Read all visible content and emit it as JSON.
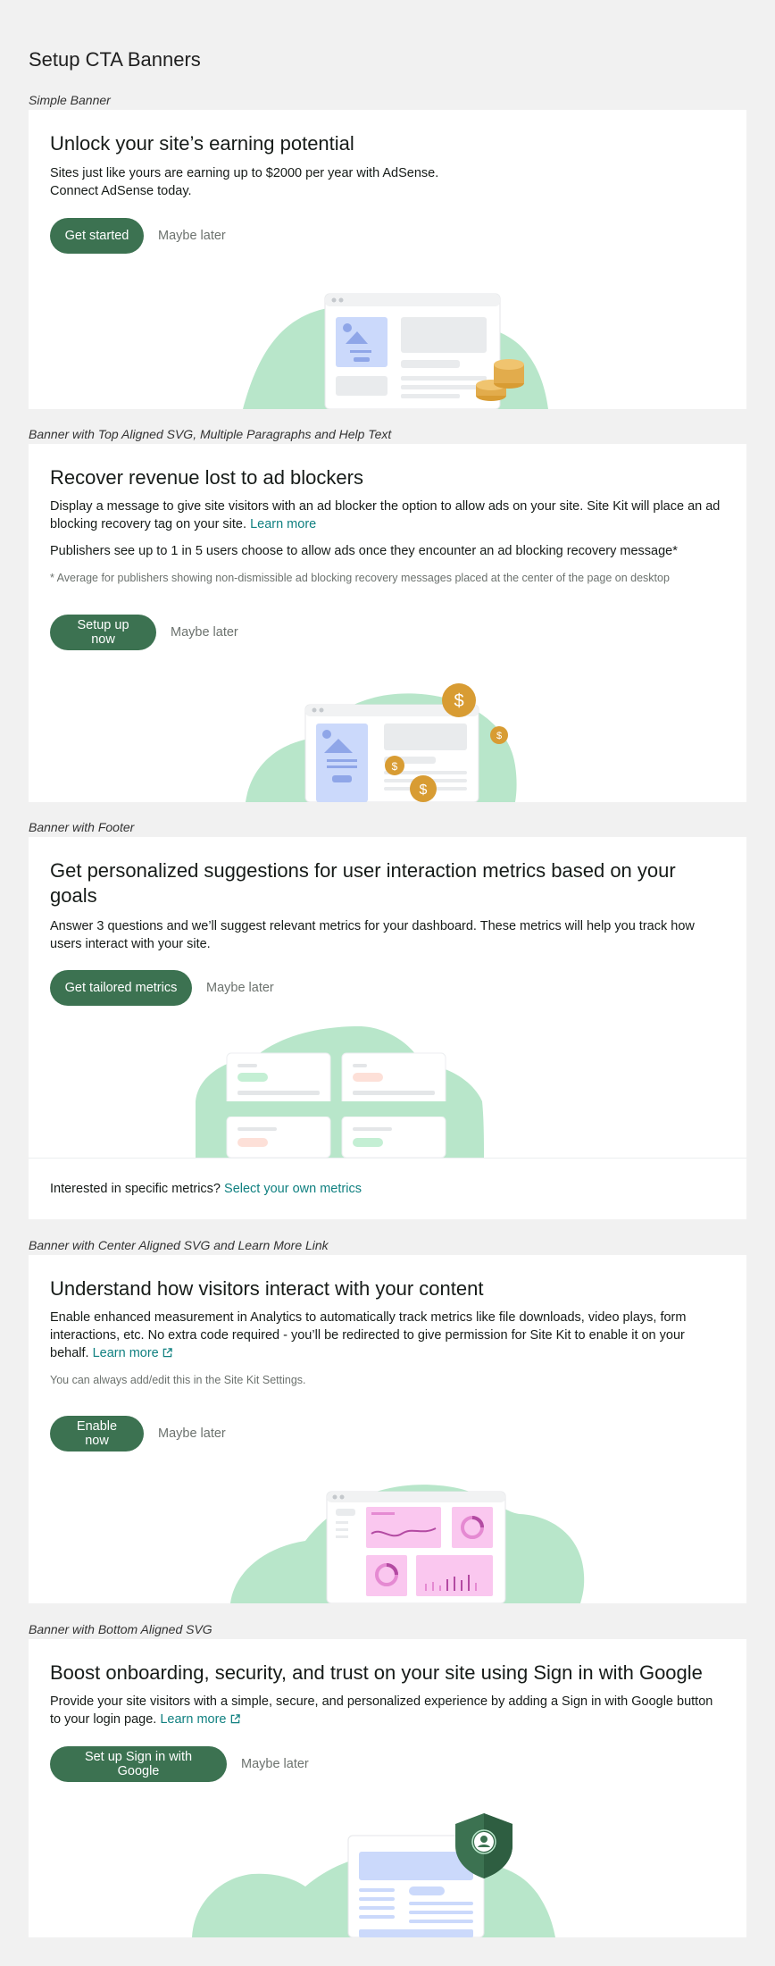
{
  "page_title": "Setup CTA Banners",
  "sections": [
    {
      "label": "Simple Banner",
      "title": "Unlock your site’s earning potential",
      "text_line1": "Sites just like yours are earning up to $2000 per year with AdSense.",
      "text_line2": "Connect AdSense today.",
      "cta_label": "Get started",
      "dismiss_label": "Maybe later"
    },
    {
      "label": "Banner with Top Aligned SVG, Multiple Paragraphs and Help Text",
      "title": "Recover revenue lost to ad blockers",
      "paragraph1": "Display a message to give site visitors with an ad blocker the option to allow ads on your site. Site Kit will place an ad blocking recovery tag on your site.",
      "learn_more": "Learn more",
      "paragraph2": "Publishers see up to 1 in 5 users choose to allow ads once they encounter an ad blocking recovery message*",
      "help_text": "* Average for publishers showing non-dismissible ad blocking recovery messages placed at the center of the page on desktop",
      "cta_label": "Setup up now",
      "dismiss_label": "Maybe later"
    },
    {
      "label": "Banner with Footer",
      "title": "Get personalized suggestions for user interaction metrics based on your goals",
      "text": "Answer 3 questions and we’ll suggest relevant metrics for your dashboard. These metrics will help you track how users interact with your site.",
      "cta_label": "Get tailored metrics",
      "dismiss_label": "Maybe later",
      "footer_text": "Interested in specific metrics?",
      "footer_link": "Select your own metrics"
    },
    {
      "label": "Banner with Center Aligned SVG and Learn More Link",
      "title": "Understand how visitors interact with your content",
      "text": "Enable enhanced measurement in Analytics to automatically track metrics like file downloads, video plays, form interactions, etc. No extra code required - you’ll be redirected to give permission for Site Kit to enable it on your behalf.",
      "learn_more": "Learn more",
      "help_text": "You can always add/edit this in the Site Kit Settings.",
      "cta_label": "Enable now",
      "dismiss_label": "Maybe later"
    },
    {
      "label": "Banner with Bottom Aligned SVG",
      "title": "Boost onboarding, security, and trust on your site using Sign in with Google",
      "text": "Provide your site visitors with a simple, secure, and personalized experience by adding a Sign in with Google button to your login page.",
      "learn_more": "Learn more",
      "cta_label": "Set up Sign in with Google",
      "dismiss_label": "Maybe later"
    }
  ],
  "colors": {
    "primary_button": "#3c7251",
    "link": "#108080",
    "blob": "#b8e6ca",
    "coin": "#d89c33",
    "page_bg": "#f1f1f1"
  },
  "icons": [
    "external-link-icon",
    "dollar-coin-icon",
    "shield-icon",
    "user-icon"
  ]
}
